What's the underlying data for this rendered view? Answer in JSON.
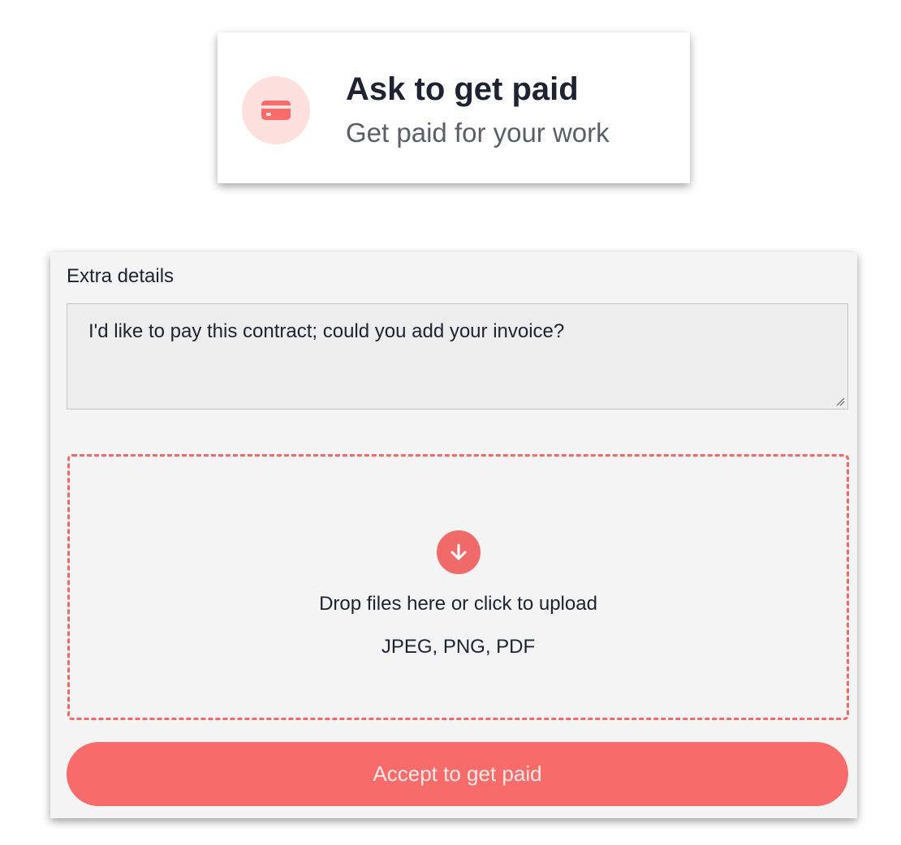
{
  "card": {
    "icon": "credit-card-icon",
    "title": "Ask to get paid",
    "subtitle": "Get paid for your work"
  },
  "form": {
    "label": "Extra details",
    "textarea_value": "I'd like to pay this contract; could you add your invoice?",
    "dropzone": {
      "icon": "arrow-down-icon",
      "text": "Drop files here or click to upload",
      "formats": "JPEG, PNG, PDF"
    },
    "submit_label": "Accept to get paid"
  },
  "colors": {
    "accent": "#f76b6b",
    "icon_bg": "#fde0dd",
    "panel_bg": "#f4f4f4"
  }
}
